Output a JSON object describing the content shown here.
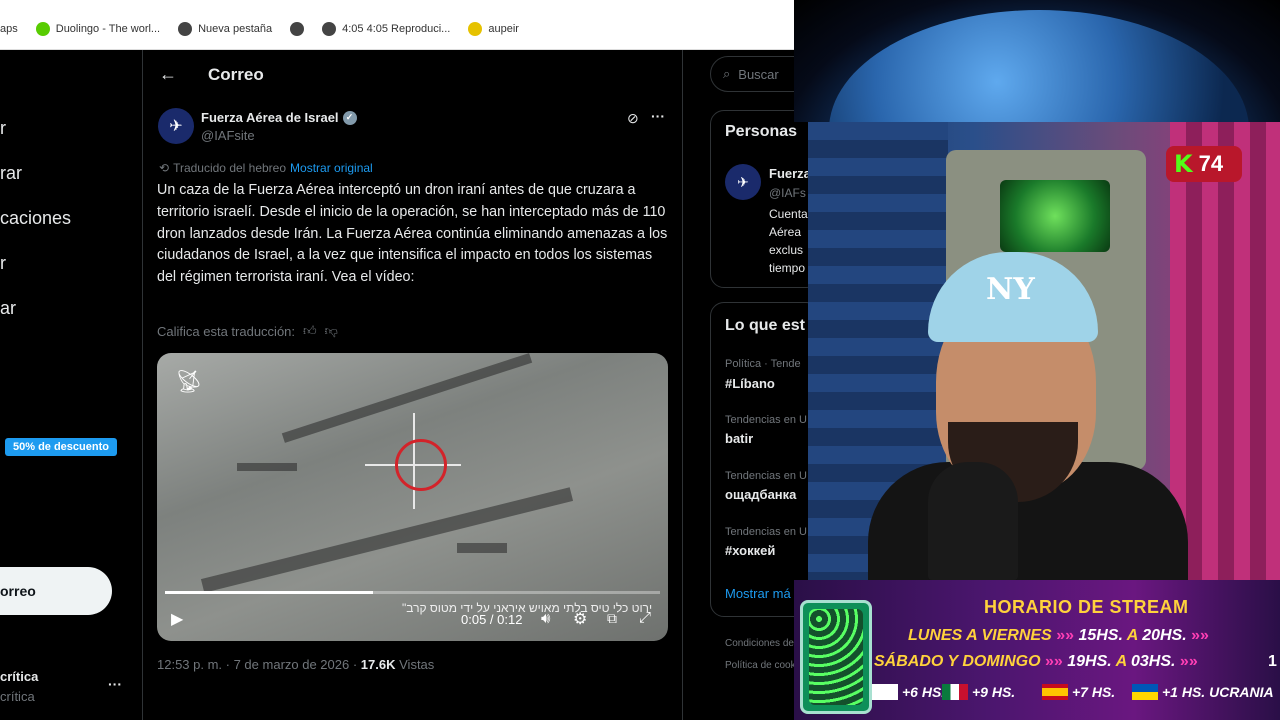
{
  "bookmarks": [
    {
      "label": "aps",
      "icon": "apps-icon",
      "color": "#ffffff"
    },
    {
      "label": "Duolingo - The worl...",
      "icon": "duolingo-icon",
      "color": "#58cc02"
    },
    {
      "label": "Nueva pestaña",
      "icon": "chrome-icon",
      "color": "#444444"
    },
    {
      "label": "",
      "icon": "globe-icon",
      "color": "#444444"
    },
    {
      "label": "4:05 4:05 Reproduci...",
      "icon": "globe-icon",
      "color": "#444444"
    },
    {
      "label": "aupeir",
      "icon": "aupeir-icon",
      "color": "#e6c200"
    }
  ],
  "leftnav": {
    "items": [
      "r",
      "rar",
      "caciones",
      "r",
      "ar"
    ],
    "promo": "50% de descuento",
    "post_button": "orreo",
    "account_name": "crítica",
    "account_handle": "crítica",
    "account_more": "···"
  },
  "header": {
    "back": "←",
    "title": "Correo"
  },
  "tweet": {
    "author_name": "Fuerza Aérea de Israel",
    "author_handle": "@IAFsite",
    "translated_label": "Traducido del hebreo",
    "show_original": "Mostrar original",
    "text": "Un caza de la Fuerza Aérea interceptó un dron iraní antes de que cruzara a territorio israelí. Desde el inicio de la operación, se han interceptado más de 110 dron lanzados desde Irán. La Fuerza Aérea continúa eliminando amenazas a los ciudadanos de Israel, a la vez que intensifica el impacto en todos los sistemas del régimen terrorista iraní. Vea el vídeo:",
    "rate_label": "Califica esta traducción:",
    "video": {
      "time": "0:05 / 0:12",
      "progress": 0.42,
      "caption": "\"ירוט כלי טיס בלתי מאויש איראני על ידי מטוס קרב"
    },
    "timestamp": "12:53 p. m. · 7 de marzo de 2026 ·",
    "views_count": "17.6K",
    "views_label": "Vistas"
  },
  "rightcol": {
    "search_placeholder": "Buscar",
    "people_title": "Personas",
    "person_name": "Fuerza",
    "person_handle": "@IAFs",
    "person_bio": [
      "Cuenta",
      "Aérea",
      "exclus",
      "tiempo"
    ],
    "trends_title": "Lo que est",
    "trends": [
      {
        "context": "Política · Tende",
        "name": "#Líbano"
      },
      {
        "context": "Tendencias en U",
        "name": "batir"
      },
      {
        "context": "Tendencias en U",
        "name": "ощадбанка"
      },
      {
        "context": "Tendencias en U",
        "name": "#хоккей"
      }
    ],
    "show_more": "Mostrar má",
    "footer": [
      "Condiciones de",
      "Política de cook"
    ]
  },
  "stream": {
    "kick_letter": "K",
    "viewers": "74",
    "cap_logo": "NY",
    "banner_title": "HORARIO DE STREAM",
    "row1_days": "LUNES A VIERNES",
    "row1_start": "15HS.",
    "row1_to": "A",
    "row1_end": "20HS.",
    "row2_days": "SÁBADO Y DOMINGO",
    "row2_start": "19HS.",
    "row2_to": "A",
    "row2_end": "03HS.",
    "tz": [
      {
        "offset": "+6 HS.",
        "label": ""
      },
      {
        "offset": "+9 HS.",
        "label": ""
      },
      {
        "offset": "+7 HS.",
        "label": ""
      },
      {
        "offset": "+1 HS.",
        "label": "UCRANIA"
      }
    ],
    "arrows": "»»",
    "edge_digit": "1"
  }
}
